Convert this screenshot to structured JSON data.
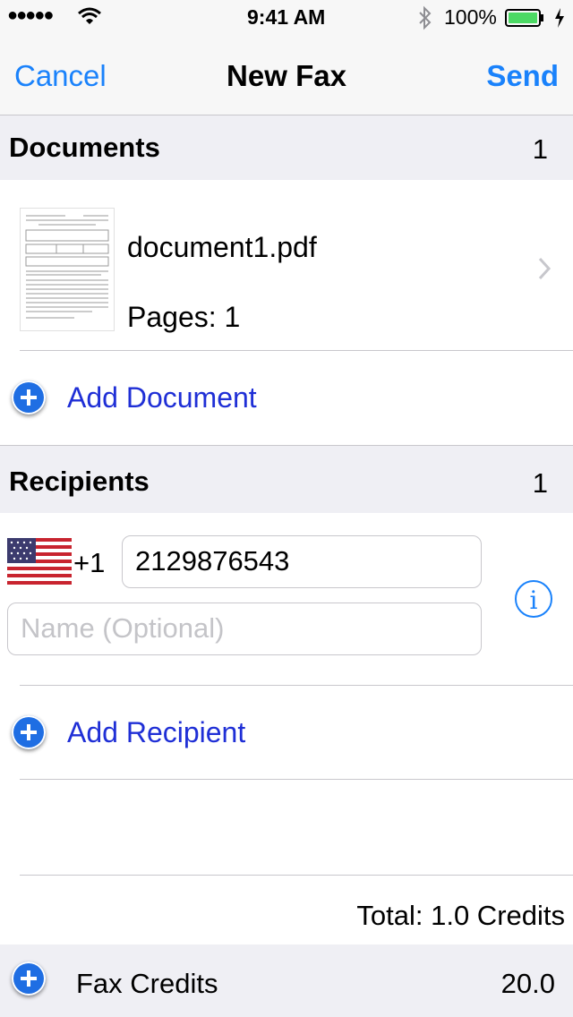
{
  "status_bar": {
    "signal": "●●●●●",
    "time": "9:41 AM",
    "battery": "100%"
  },
  "nav": {
    "cancel": "Cancel",
    "title": "New Fax",
    "send": "Send"
  },
  "documents": {
    "header": "Documents",
    "count": "1",
    "item": {
      "name": "document1.pdf",
      "pages": "Pages: 1"
    },
    "add": "Add Document"
  },
  "recipients": {
    "header": "Recipients",
    "count": "1",
    "country_code": "+1",
    "number": "2129876543",
    "name_placeholder": "Name (Optional)",
    "add": "Add Recipient"
  },
  "total": "Total: 1.0 Credits",
  "credits": {
    "label": "Fax Credits",
    "value": "20.0"
  },
  "colors": {
    "accent": "#1a82fb",
    "link": "#1f2fd6",
    "section_bg": "#efeff4"
  }
}
